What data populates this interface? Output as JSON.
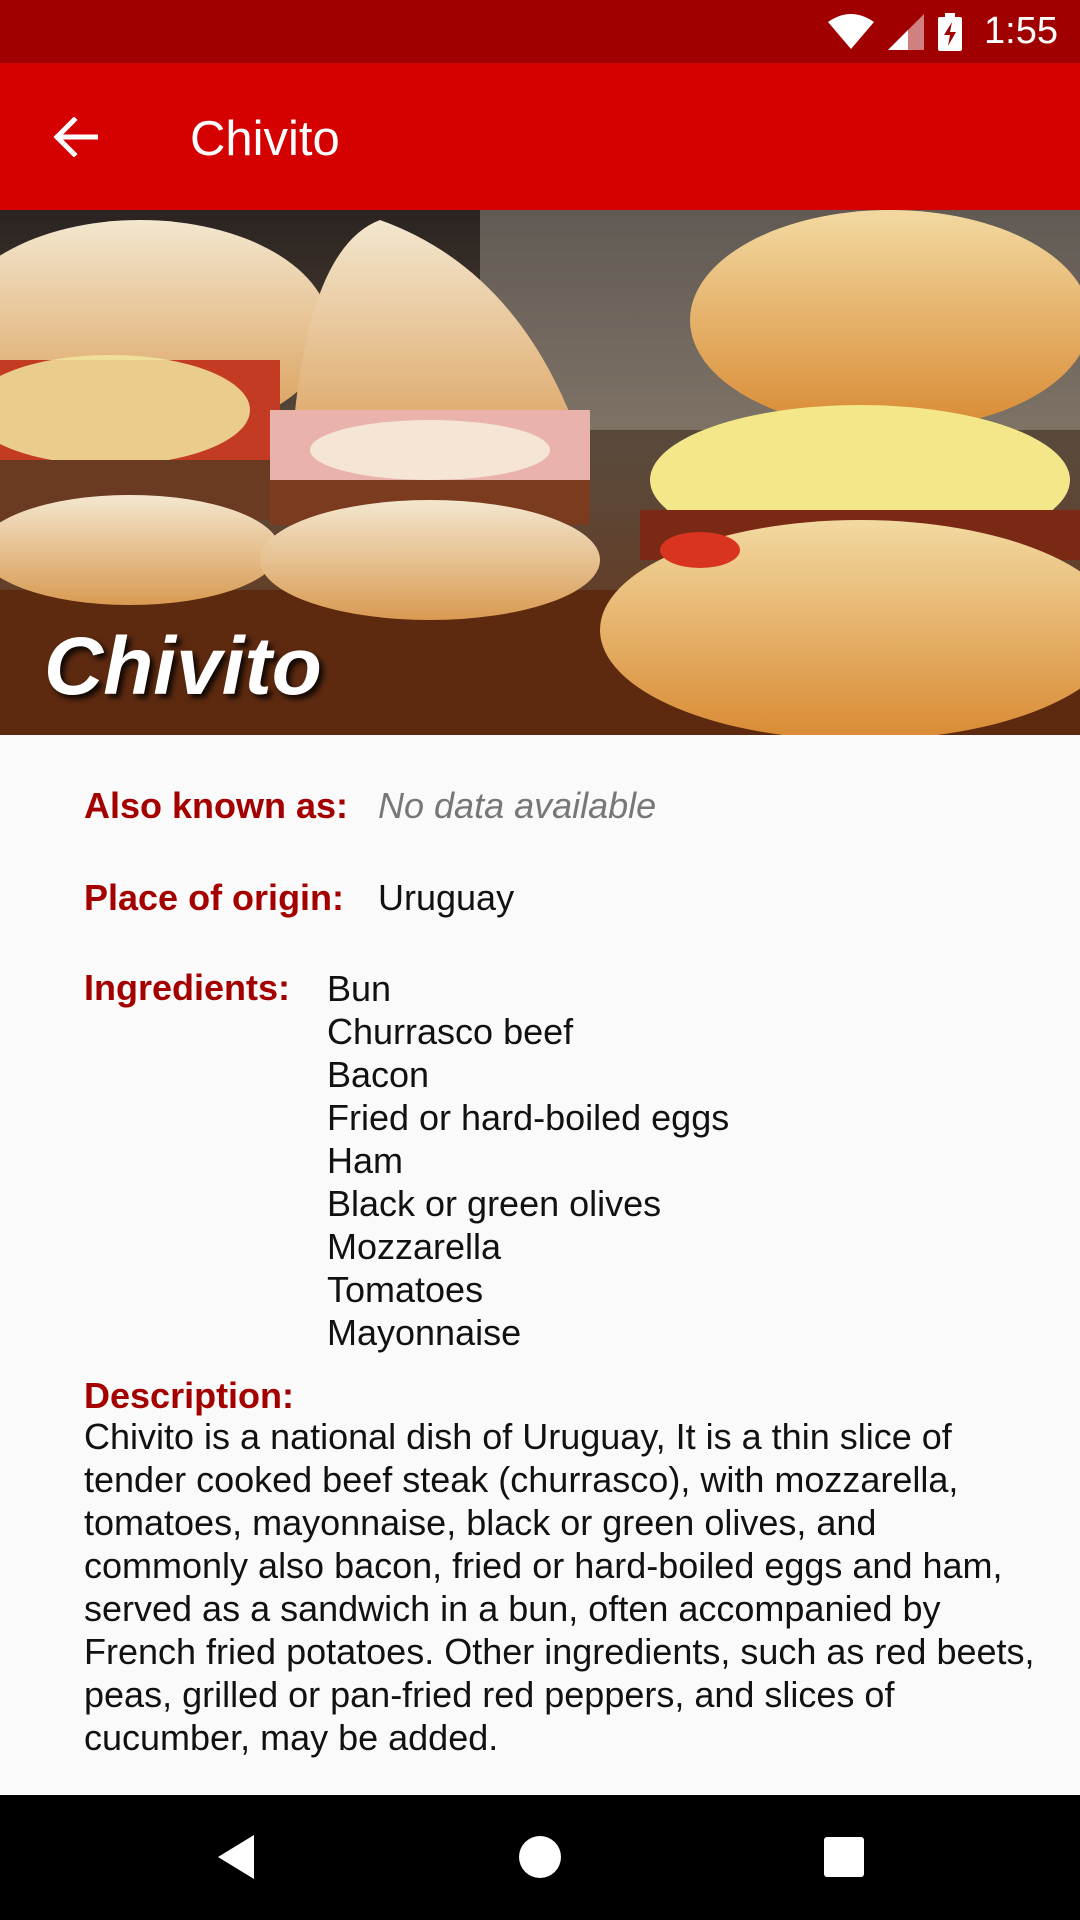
{
  "status_bar": {
    "time": "1:55"
  },
  "app_bar": {
    "title": "Chivito"
  },
  "hero": {
    "title": "Chivito"
  },
  "details": {
    "also_known_as_label": "Also known as:",
    "also_known_as_value": "No data available",
    "place_of_origin_label": "Place of origin:",
    "place_of_origin_value": "Uruguay",
    "ingredients_label": "Ingredients:",
    "ingredients": [
      "Bun",
      "Churrasco beef",
      "Bacon",
      "Fried or hard-boiled eggs",
      "Ham",
      "Black or green olives",
      "Mozzarella",
      "Tomatoes",
      "Mayonnaise"
    ],
    "description_label": "Description:",
    "description": "Chivito is a national dish of Uruguay, It is a thin slice of tender cooked beef steak (churrasco), with mozzarella, tomatoes, mayonnaise, black or green olives, and commonly also bacon, fried or hard-boiled eggs and ham, served as a sandwich in a bun, often accompanied by French fried potatoes. Other ingredients, such as red beets, peas, grilled or pan-fried red peppers, and slices of cucumber, may be added."
  },
  "colors": {
    "status_bar": "#a00000",
    "app_bar": "#d50000",
    "label": "#a40000"
  },
  "icons": {
    "back": "arrow-left-icon",
    "wifi": "wifi-icon",
    "signal": "cell-signal-icon",
    "battery": "battery-charging-icon",
    "nav_back": "triangle-back-icon",
    "nav_home": "circle-home-icon",
    "nav_recents": "square-recents-icon"
  }
}
